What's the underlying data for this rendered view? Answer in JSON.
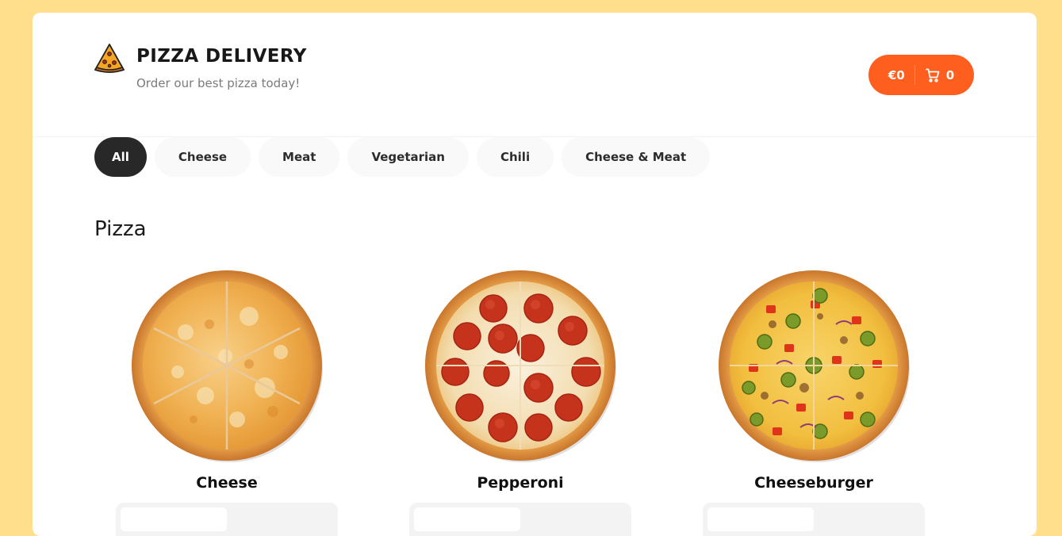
{
  "header": {
    "title": "PIZZA DELIVERY",
    "subtitle": "Order our best pizza today!",
    "logo_icon": "pizza-slice-icon"
  },
  "cart": {
    "price": "€0",
    "count": "0",
    "icon": "cart-icon",
    "color": "#fe5f1e"
  },
  "categories": [
    {
      "label": "All",
      "active": true
    },
    {
      "label": "Cheese",
      "active": false
    },
    {
      "label": "Meat",
      "active": false
    },
    {
      "label": "Vegetarian",
      "active": false
    },
    {
      "label": "Chili",
      "active": false
    },
    {
      "label": "Cheese & Meat",
      "active": false
    }
  ],
  "section": {
    "title": "Pizza"
  },
  "pizzas": [
    {
      "name": "Cheese",
      "image": "cheese-pizza"
    },
    {
      "name": "Pepperoni",
      "image": "pepperoni-pizza"
    },
    {
      "name": "Cheeseburger",
      "image": "cheeseburger-pizza"
    }
  ],
  "colors": {
    "page_background": "#ffdf8c",
    "accent": "#fe5f1e",
    "active_category": "#282828"
  }
}
